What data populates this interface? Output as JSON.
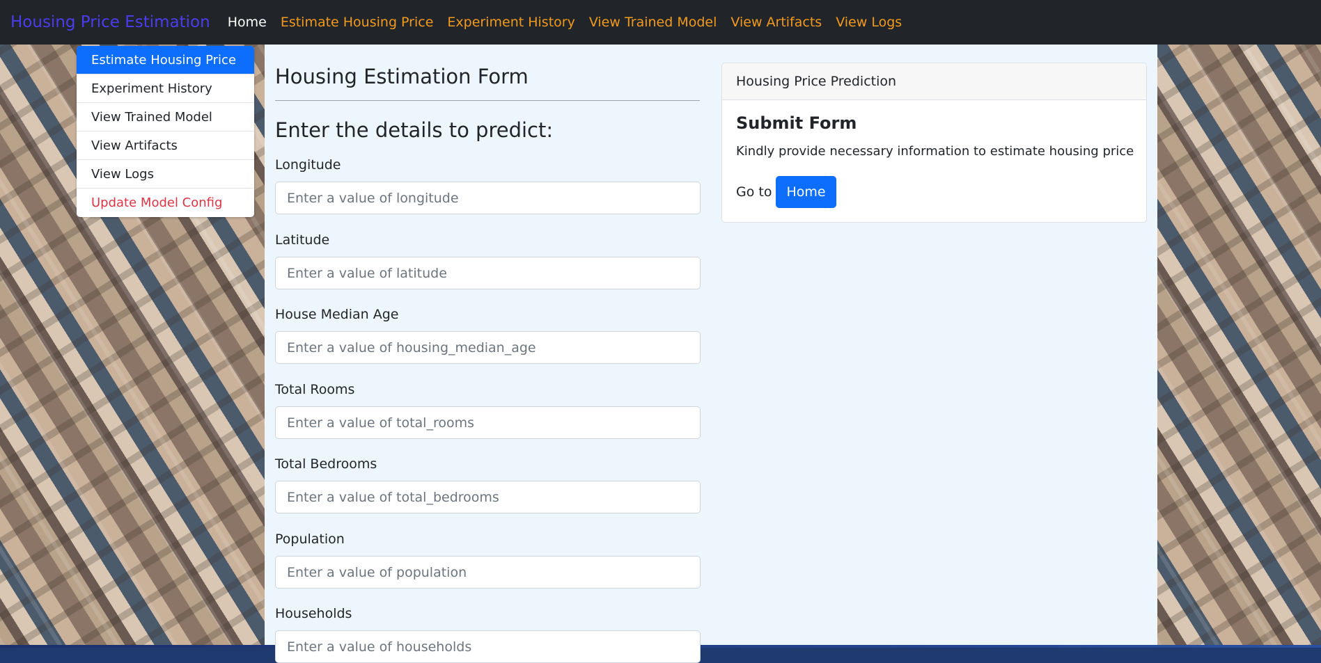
{
  "navbar": {
    "brand": "Housing Price Estimation",
    "links": [
      {
        "label": "Home",
        "active": true
      },
      {
        "label": "Estimate Housing Price"
      },
      {
        "label": "Experiment History"
      },
      {
        "label": "View Trained Model"
      },
      {
        "label": "View Artifacts"
      },
      {
        "label": "View Logs"
      }
    ]
  },
  "side_menu": {
    "items": [
      {
        "label": "Estimate Housing Price",
        "state": "active"
      },
      {
        "label": "Experiment History"
      },
      {
        "label": "View Trained Model"
      },
      {
        "label": "View Artifacts"
      },
      {
        "label": "View Logs"
      },
      {
        "label": "Update Model Config",
        "state": "danger"
      }
    ]
  },
  "form": {
    "title": "Housing Estimation Form",
    "subtitle": "Enter the details to predict:",
    "fields": [
      {
        "label": "Longitude",
        "placeholder": "Enter a value of longitude",
        "value": ""
      },
      {
        "label": "Latitude",
        "placeholder": "Enter a value of latitude",
        "value": ""
      },
      {
        "label": "House Median Age",
        "placeholder": "Enter a value of housing_median_age",
        "value": ""
      },
      {
        "label": "Total Rooms",
        "placeholder": "Enter a value of total_rooms",
        "value": ""
      },
      {
        "label": "Total Bedrooms",
        "placeholder": "Enter a value of total_bedrooms",
        "value": ""
      },
      {
        "label": "Population",
        "placeholder": "Enter a value of population",
        "value": ""
      },
      {
        "label": "Households",
        "placeholder": "Enter a value of households",
        "value": ""
      }
    ]
  },
  "card": {
    "header": "Housing Price Prediction",
    "title": "Submit Form",
    "text": "Kindly provide necessary information to estimate housing price",
    "goto_label": "Go to",
    "home_button": "Home"
  },
  "colors": {
    "navbar_bg": "#212529",
    "brand": "#4b3cf0",
    "nav_link": "#f39a1c",
    "primary": "#0d6efd",
    "danger": "#dc3545",
    "content_bg": "#eef6fd"
  }
}
